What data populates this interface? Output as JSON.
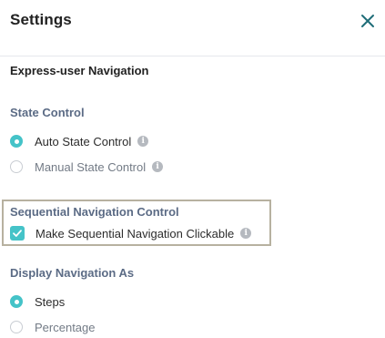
{
  "header": {
    "title": "Settings",
    "close_icon": "close-icon"
  },
  "section": {
    "title": "Express-user Navigation"
  },
  "state_control": {
    "label": "State Control",
    "options": [
      {
        "label": "Auto State Control",
        "checked": true,
        "info_icon": "info-icon"
      },
      {
        "label": "Manual State Control",
        "checked": false,
        "info_icon": "info-icon"
      }
    ]
  },
  "sequential_navigation": {
    "label": "Sequential Navigation Control",
    "checkbox": {
      "label": "Make Sequential Navigation Clickable",
      "checked": true,
      "info_icon": "info-icon"
    }
  },
  "display_navigation": {
    "label": "Display Navigation As",
    "options": [
      {
        "label": "Steps",
        "checked": true
      },
      {
        "label": "Percentage",
        "checked": false
      }
    ]
  },
  "colors": {
    "accent": "#45c3c8",
    "group_label": "#5b6b85",
    "highlight_border": "#b7b1a0"
  }
}
